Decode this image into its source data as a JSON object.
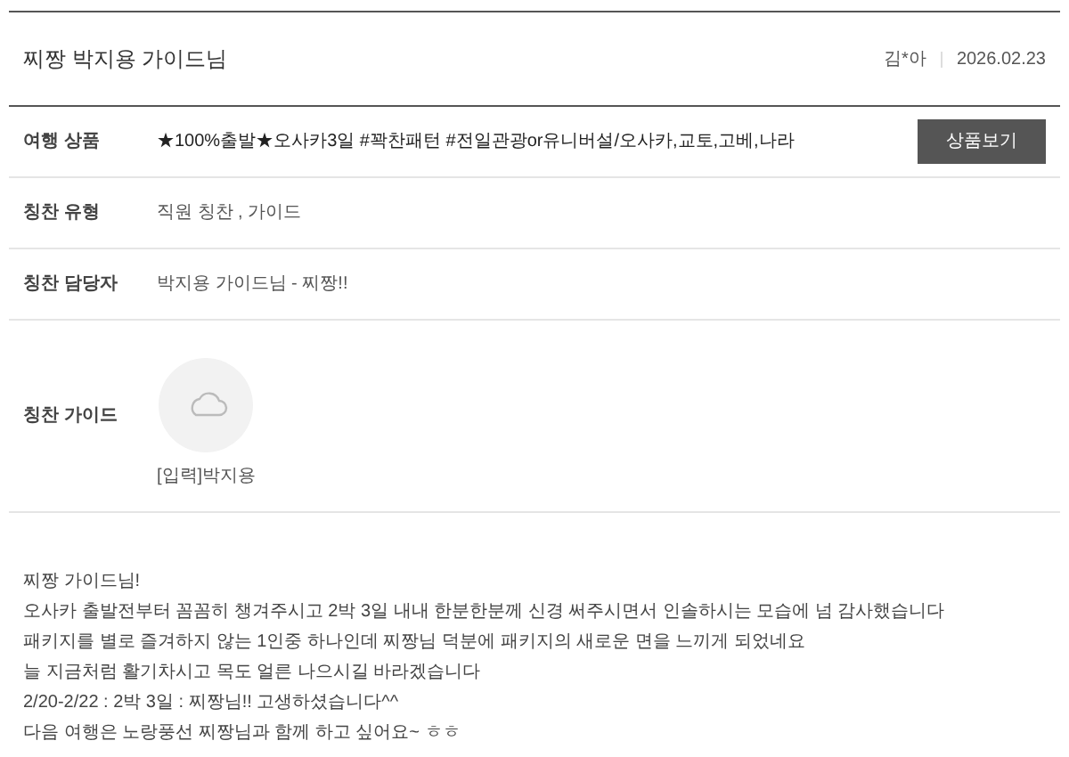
{
  "header": {
    "title": "찌짱 박지용 가이드님",
    "author": "김*아",
    "date": "2026.02.23"
  },
  "rows": [
    {
      "kind": "product",
      "label": "여행 상품",
      "value": "★100%출발★오사카3일 #꽉찬패턴 #전일관광or유니버설/오사카,교토,고베,나라",
      "button": "상품보기"
    },
    {
      "kind": "text",
      "label": "칭찬 유형",
      "value": "직원 칭찬 , 가이드"
    },
    {
      "kind": "text",
      "label": "칭찬 담당자",
      "value": "박지용 가이드님 - 찌짱!!"
    },
    {
      "kind": "guide",
      "label": "칭찬 가이드",
      "caption": "[입력]박지용"
    }
  ],
  "body": [
    "찌짱 가이드님!",
    "오사카 출발전부터 꼼꼼히 챙겨주시고 2박 3일 내내 한분한분께 신경 써주시면서 인솔하시는 모습에 넘 감사했습니다",
    "패키지를 별로 즐겨하지 않는 1인중 하나인데 찌짱님 덕분에 패키지의 새로운 면을 느끼게 되었네요",
    "늘 지금처럼 활기차시고 목도 얼른 나으시길 바라겠습니다",
    "2/20-2/22 : 2박 3일 : 찌짱님!! 고생하셨습니다^^",
    "다음 여행은 노랑풍선 찌짱님과 함께 하고 싶어요~ ㅎㅎ"
  ]
}
